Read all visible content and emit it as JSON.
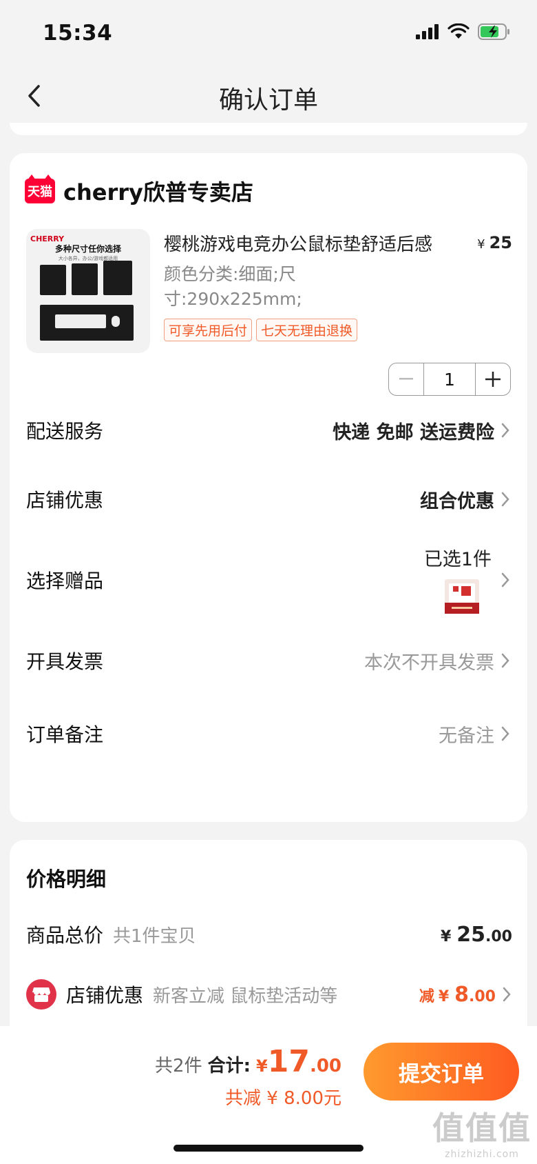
{
  "status": {
    "time": "15:34"
  },
  "nav": {
    "title": "确认订单"
  },
  "store": {
    "badge": "天猫",
    "name": "cherry欣普专卖店"
  },
  "product": {
    "image": {
      "brand": "CHERRY",
      "title": "多种尺寸任你选择",
      "subtitle": "大小各异，办公/游戏都适用"
    },
    "title": "樱桃游戏电竞办公鼠标垫舒适后感",
    "price_symbol": "¥",
    "price": "25",
    "spec": "颜色分类:细面;尺寸:290x225mm;",
    "tags": [
      "可享先用后付",
      "七天无理由退换"
    ],
    "quantity": "1"
  },
  "rows": {
    "delivery": {
      "label": "配送服务",
      "value": "快递 免邮 送运费险"
    },
    "store_discount": {
      "label": "店铺优惠",
      "value": "组合优惠"
    },
    "gift": {
      "label": "选择赠品",
      "value": "已选1件"
    },
    "invoice": {
      "label": "开具发票",
      "value": "本次不开具发票"
    },
    "remark": {
      "label": "订单备注",
      "value": "无备注"
    }
  },
  "price_detail": {
    "heading": "价格明细",
    "goods_total": {
      "label": "商品总价",
      "sub": "共1件宝贝",
      "yen": "¥",
      "int": "25",
      "dec": ".00"
    },
    "store_discount": {
      "label": "店铺优惠",
      "sub": "新客立减 鼠标垫活动等",
      "prefix": "减",
      "yen": "¥",
      "int": "8",
      "dec": ".00"
    }
  },
  "bottom": {
    "count": "共2件",
    "sum_label": "合计:",
    "yen": "¥",
    "int": "17",
    "dec": ".00",
    "saving": "共减 ¥ 8.00元",
    "submit": "提交订单"
  },
  "watermark": {
    "main": "值值值",
    "sub": "zhizhizhi.com"
  },
  "colors": {
    "accent": "#f05a28",
    "tmall_red": "#ff0036",
    "button_start": "#ff9a2e",
    "button_end": "#ff5b20"
  }
}
